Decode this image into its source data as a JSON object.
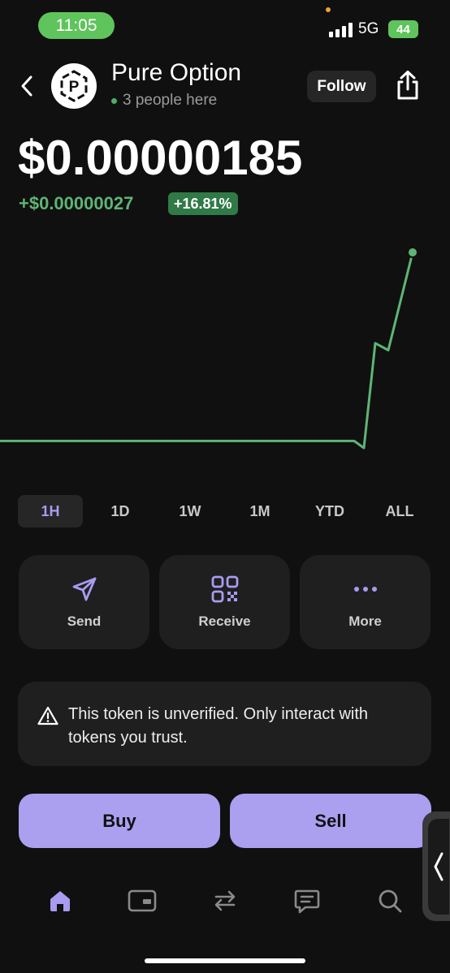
{
  "status_bar": {
    "time": "11:05",
    "network": "5G",
    "battery": "44"
  },
  "header": {
    "token_name": "Pure Option",
    "logo_letter": "P",
    "presence": "3 people here",
    "follow_label": "Follow"
  },
  "price": {
    "value": "$0.00000185",
    "change": "+$0.00000027",
    "change_pct": "+16.81%"
  },
  "chart_data": {
    "type": "line",
    "color": "#5db574",
    "y": [
      1.58e-06,
      1.58e-06,
      1.58e-06,
      1.58e-06,
      1.58e-06,
      1.58e-06,
      1.58e-06,
      1.57e-06,
      1.72e-06,
      1.71e-06,
      1.85e-06
    ]
  },
  "timeframes": [
    {
      "label": "1H",
      "active": true
    },
    {
      "label": "1D",
      "active": false
    },
    {
      "label": "1W",
      "active": false
    },
    {
      "label": "1M",
      "active": false
    },
    {
      "label": "YTD",
      "active": false
    },
    {
      "label": "ALL",
      "active": false
    }
  ],
  "actions": {
    "send": "Send",
    "receive": "Receive",
    "more": "More"
  },
  "warning": {
    "text": "This token is unverified. Only interact with tokens you trust."
  },
  "trade": {
    "buy": "Buy",
    "sell": "Sell"
  },
  "nav": {
    "active_color": "#a99bf0",
    "icons": [
      "home-icon",
      "wallet-icon",
      "swap-icon",
      "chat-icon",
      "search-icon"
    ]
  },
  "colors": {
    "accent": "#ab9ff0",
    "positive": "#5db574",
    "background": "#101010"
  }
}
